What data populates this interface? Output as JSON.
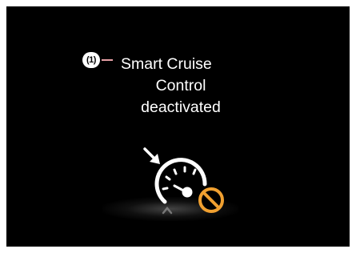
{
  "callout": {
    "label": "(1)",
    "line_color": "#e7a0a6"
  },
  "message": {
    "line1": "Smart Cruise",
    "line2": "Control",
    "line3": "deactivated"
  },
  "icon": {
    "name": "smart-cruise-control-off-icon",
    "gauge_color": "#ffffff",
    "prohibit_color": "#f0a030"
  }
}
